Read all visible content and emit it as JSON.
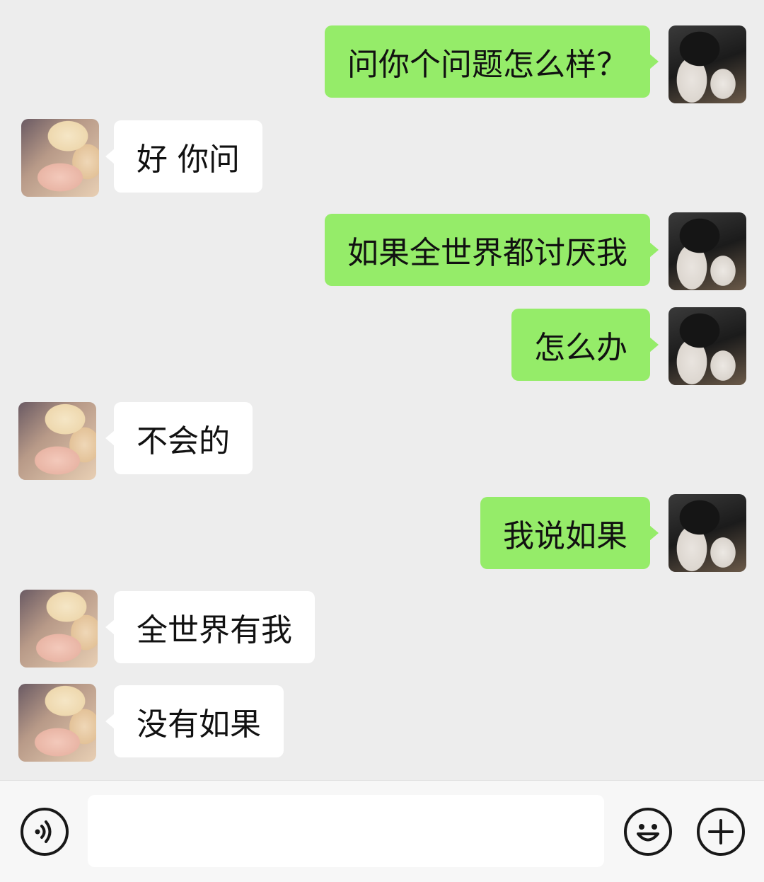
{
  "messages": [
    {
      "from": "self",
      "text": "问你个问题怎么样？"
    },
    {
      "from": "other",
      "text": "好 你问"
    },
    {
      "from": "self",
      "text": "如果全世界都讨厌我"
    },
    {
      "from": "self",
      "text": "怎么办"
    },
    {
      "from": "other",
      "text": "不会的"
    },
    {
      "from": "self",
      "text": "我说如果"
    },
    {
      "from": "other",
      "text": "全世界有我"
    },
    {
      "from": "other",
      "text": "没有如果"
    }
  ],
  "input_bar": {
    "voice_icon": "voice-icon",
    "emoji_icon": "emoji-icon",
    "plus_icon": "plus-icon",
    "input_value": ""
  },
  "colors": {
    "background": "#ededed",
    "self_bubble": "#95ec69",
    "other_bubble": "#ffffff"
  }
}
